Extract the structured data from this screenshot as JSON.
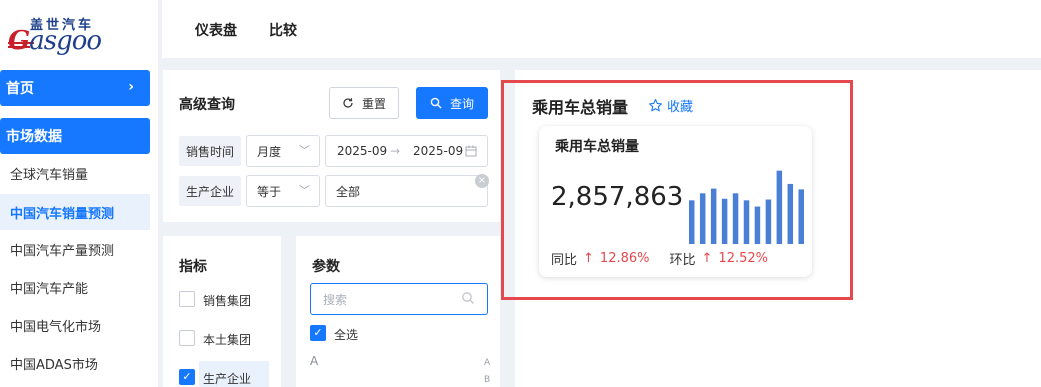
{
  "brand": {
    "cn": "盖世汽车",
    "en_prefix": "G",
    "en_rest": "asgoo"
  },
  "sidebar": {
    "home": "首页",
    "section": "市场数据",
    "items": [
      {
        "label": "全球汽车销量"
      },
      {
        "label": "中国汽车销量预测"
      },
      {
        "label": "中国汽车产量预测"
      },
      {
        "label": "中国汽车产能"
      },
      {
        "label": "中国电气化市场"
      },
      {
        "label": "中国ADAS市场"
      }
    ]
  },
  "topbar": {
    "tabs": [
      "仪表盘",
      "比较"
    ]
  },
  "query": {
    "title": "高级查询",
    "reset_label": "重置",
    "search_label": "查询",
    "sales_time_label": "销售时间",
    "period_value": "月度",
    "range_start": "2025-09",
    "range_end": "2025-09",
    "manufacturer_label": "生产企业",
    "operator_value": "等于",
    "manufacturer_value": "全部"
  },
  "indicators": {
    "title": "指标",
    "options": [
      {
        "label": "销售集团",
        "checked": false
      },
      {
        "label": "本土集团",
        "checked": false
      },
      {
        "label": "生产企业",
        "checked": true
      }
    ]
  },
  "params": {
    "title": "参数",
    "search_placeholder": "搜索",
    "select_all": "全选",
    "letter": "A",
    "index_letters": [
      "A",
      "B"
    ]
  },
  "main": {
    "section_title": "乘用车总销量",
    "favorite_label": "收藏",
    "card": {
      "title": "乘用车总销量",
      "value": "2,857,863",
      "yoy_label": "同比",
      "yoy_value": "12.86%",
      "mom_label": "环比",
      "mom_value": "12.52%",
      "sparkline": [
        0.56,
        0.65,
        0.71,
        0.58,
        0.65,
        0.56,
        0.48,
        0.57,
        0.94,
        0.77,
        0.7
      ],
      "bar_color": "#4a7fd6"
    }
  },
  "colors": {
    "accent": "#1677ff",
    "highlight_border": "#e5484d",
    "up": "#e5484d"
  }
}
